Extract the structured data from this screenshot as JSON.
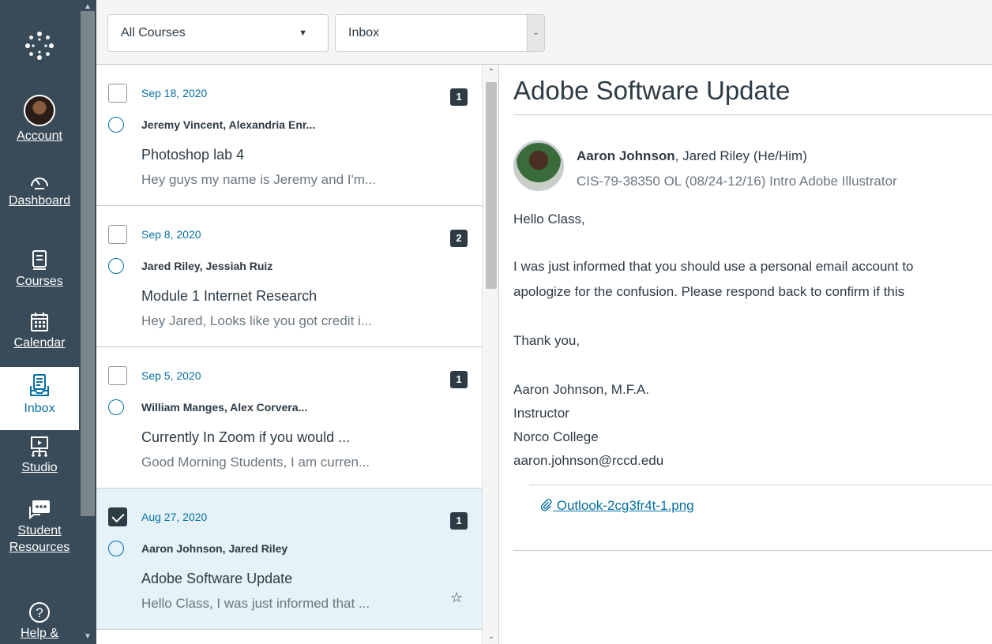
{
  "nav": {
    "items": [
      {
        "label": "Account",
        "icon": "avatar"
      },
      {
        "label": "Dashboard",
        "icon": "dashboard-icon"
      },
      {
        "label": "Courses",
        "icon": "courses-icon"
      },
      {
        "label": "Calendar",
        "icon": "calendar-icon"
      },
      {
        "label": "Inbox",
        "icon": "inbox-icon",
        "active": true
      },
      {
        "label": "Studio",
        "icon": "studio-icon"
      },
      {
        "label": "Student Resources",
        "icon": "student-resources-icon"
      },
      {
        "label": "Help &",
        "icon": "help-icon"
      }
    ]
  },
  "toolbar": {
    "course_filter": "All Courses",
    "mailbox_filter": "Inbox"
  },
  "messages": [
    {
      "date": "Sep 18, 2020",
      "count": "1",
      "participants": "Jeremy Vincent, Alexandria Enr...",
      "subject": "Photoshop lab 4",
      "preview": "Hey guys my name is Jeremy and I'm...",
      "checked": false
    },
    {
      "date": "Sep 8, 2020",
      "count": "2",
      "participants": "Jared Riley, Jessiah Ruiz",
      "subject": "Module 1 Internet Research",
      "preview": "Hey Jared, Looks like you got credit i...",
      "checked": false
    },
    {
      "date": "Sep 5, 2020",
      "count": "1",
      "participants": "William Manges, Alex Corvera...",
      "subject": "Currently In Zoom if you would ...",
      "preview": "Good Morning Students, I am curren...",
      "checked": false
    },
    {
      "date": "Aug 27, 2020",
      "count": "1",
      "participants": "Aaron Johnson, Jared Riley",
      "subject": "Adobe Software Update",
      "preview": "Hello Class, I was just informed that ...",
      "checked": true,
      "star": "☆"
    }
  ],
  "view": {
    "title": "Adobe Software Update",
    "author": "Aaron Johnson",
    "recipients": ", Jared Riley (He/Him)",
    "context": "CIS-79-38350 OL (08/24-12/16) Intro Adobe Illustrator",
    "body": [
      "Hello Class,",
      "I was just informed that you should use a personal email account to",
      "apologize for the confusion. Please respond back to confirm if this",
      "Thank you,",
      "Aaron Johnson, M.F.A.",
      "Instructor",
      "Norco College",
      "aaron.johnson@rccd.edu"
    ],
    "attachment": " Outlook-2cg3fr4t-1.png"
  },
  "colors": {
    "nav_bg": "#394b58",
    "link": "#0770a3",
    "selected_bg": "#e5f2f8",
    "badge": "#2d3b45"
  }
}
